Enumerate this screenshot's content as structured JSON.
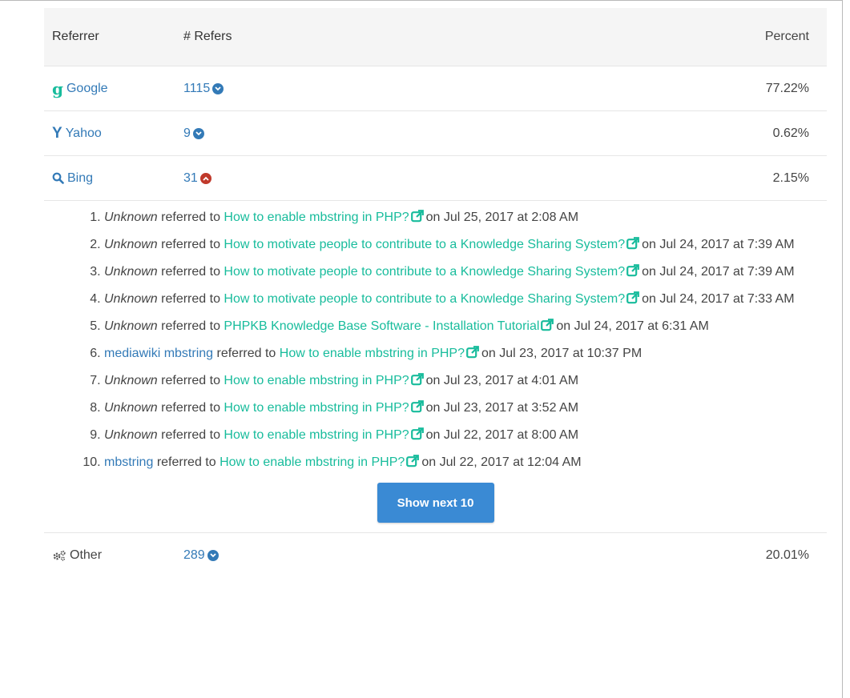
{
  "table": {
    "headers": {
      "referrer": "Referrer",
      "refers": "# Refers",
      "percent": "Percent"
    },
    "rows": [
      {
        "name": "Google",
        "icon": "google-icon",
        "count": "1115",
        "toggle": "expand",
        "percent": "77.22%"
      },
      {
        "name": "Yahoo",
        "icon": "yahoo-icon",
        "count": "9",
        "toggle": "expand",
        "percent": "0.62%"
      },
      {
        "name": "Bing",
        "icon": "search-icon",
        "count": "31",
        "toggle": "collapse",
        "percent": "2.15%"
      },
      {
        "name": "Other",
        "icon": "cogs-icon",
        "count": "289",
        "toggle": "expand",
        "percent": "20.01%"
      }
    ]
  },
  "bing_details": {
    "referred_to": "referred to",
    "on": "on",
    "items": [
      {
        "source": "Unknown",
        "source_is_link": false,
        "page": "How to enable mbstring in PHP?",
        "date": "Jul 25, 2017 at 2:08 AM"
      },
      {
        "source": "Unknown",
        "source_is_link": false,
        "page": "How to motivate people to contribute to a Knowledge Sharing System?",
        "date": "Jul 24, 2017 at 7:39 AM"
      },
      {
        "source": "Unknown",
        "source_is_link": false,
        "page": "How to motivate people to contribute to a Knowledge Sharing System?",
        "date": "Jul 24, 2017 at 7:39 AM"
      },
      {
        "source": "Unknown",
        "source_is_link": false,
        "page": "How to motivate people to contribute to a Knowledge Sharing System?",
        "date": "Jul 24, 2017 at 7:33 AM"
      },
      {
        "source": "Unknown",
        "source_is_link": false,
        "page": "PHPKB Knowledge Base Software - Installation Tutorial",
        "date": "Jul 24, 2017 at 6:31 AM"
      },
      {
        "source": "mediawiki mbstring",
        "source_is_link": true,
        "page": "How to enable mbstring in PHP?",
        "date": "Jul 23, 2017 at 10:37 PM"
      },
      {
        "source": "Unknown",
        "source_is_link": false,
        "page": "How to enable mbstring in PHP?",
        "date": "Jul 23, 2017 at 4:01 AM"
      },
      {
        "source": "Unknown",
        "source_is_link": false,
        "page": "How to enable mbstring in PHP?",
        "date": "Jul 23, 2017 at 3:52 AM"
      },
      {
        "source": "Unknown",
        "source_is_link": false,
        "page": "How to enable mbstring in PHP?",
        "date": "Jul 22, 2017 at 8:00 AM"
      },
      {
        "source": "mbstring",
        "source_is_link": true,
        "page": "How to enable mbstring in PHP?",
        "date": "Jul 22, 2017 at 12:04 AM"
      }
    ],
    "show_next_label": "Show next 10"
  },
  "colors": {
    "link_blue": "#337ab7",
    "page_green": "#18bc9c",
    "collapse_red": "#c0392b",
    "button_blue": "#3a8ad4",
    "header_bg": "#f5f5f5"
  }
}
